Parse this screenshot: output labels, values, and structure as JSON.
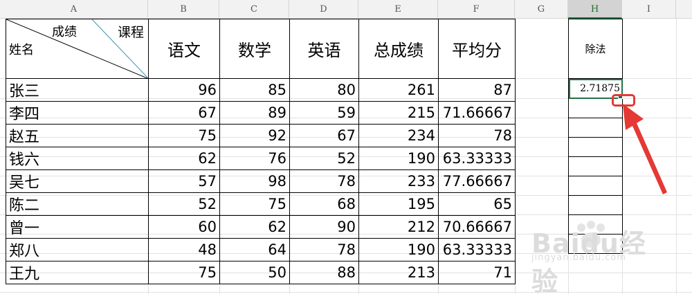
{
  "columns": [
    "A",
    "B",
    "C",
    "D",
    "E",
    "F",
    "G",
    "H",
    "I"
  ],
  "selected_column": "H",
  "header": {
    "course_label": "课程",
    "score_label": "成绩",
    "name_label": "姓名",
    "subjects": [
      "语文",
      "数学",
      "英语",
      "总成绩",
      "平均分"
    ]
  },
  "rows": [
    {
      "name": "张三",
      "chinese": "96",
      "math": "85",
      "english": "80",
      "total": "261",
      "average": "87"
    },
    {
      "name": "李四",
      "chinese": "67",
      "math": "89",
      "english": "59",
      "total": "215",
      "average": "71.66667"
    },
    {
      "name": "赵五",
      "chinese": "75",
      "math": "92",
      "english": "67",
      "total": "234",
      "average": "78"
    },
    {
      "name": "钱六",
      "chinese": "62",
      "math": "76",
      "english": "52",
      "total": "190",
      "average": "63.33333"
    },
    {
      "name": "吴七",
      "chinese": "57",
      "math": "98",
      "english": "78",
      "total": "233",
      "average": "77.66667"
    },
    {
      "name": "陈二",
      "chinese": "52",
      "math": "75",
      "english": "68",
      "total": "195",
      "average": "65"
    },
    {
      "name": "曾一",
      "chinese": "60",
      "math": "62",
      "english": "90",
      "total": "212",
      "average": "70.66667"
    },
    {
      "name": "郑八",
      "chinese": "48",
      "math": "64",
      "english": "78",
      "total": "190",
      "average": "63.33333"
    },
    {
      "name": "王九",
      "chinese": "75",
      "math": "50",
      "english": "88",
      "total": "213",
      "average": "71"
    }
  ],
  "division": {
    "header": "除法",
    "value": "2.71875"
  },
  "watermark": {
    "brand": "Baidu经验",
    "sub": "jingyan.baidu.com"
  },
  "colors": {
    "selection": "#217346",
    "annotation": "#e53935",
    "diagonal_course": "#3a8fb5"
  },
  "icons": [
    "fill-handle-icon",
    "red-arrow-icon"
  ]
}
